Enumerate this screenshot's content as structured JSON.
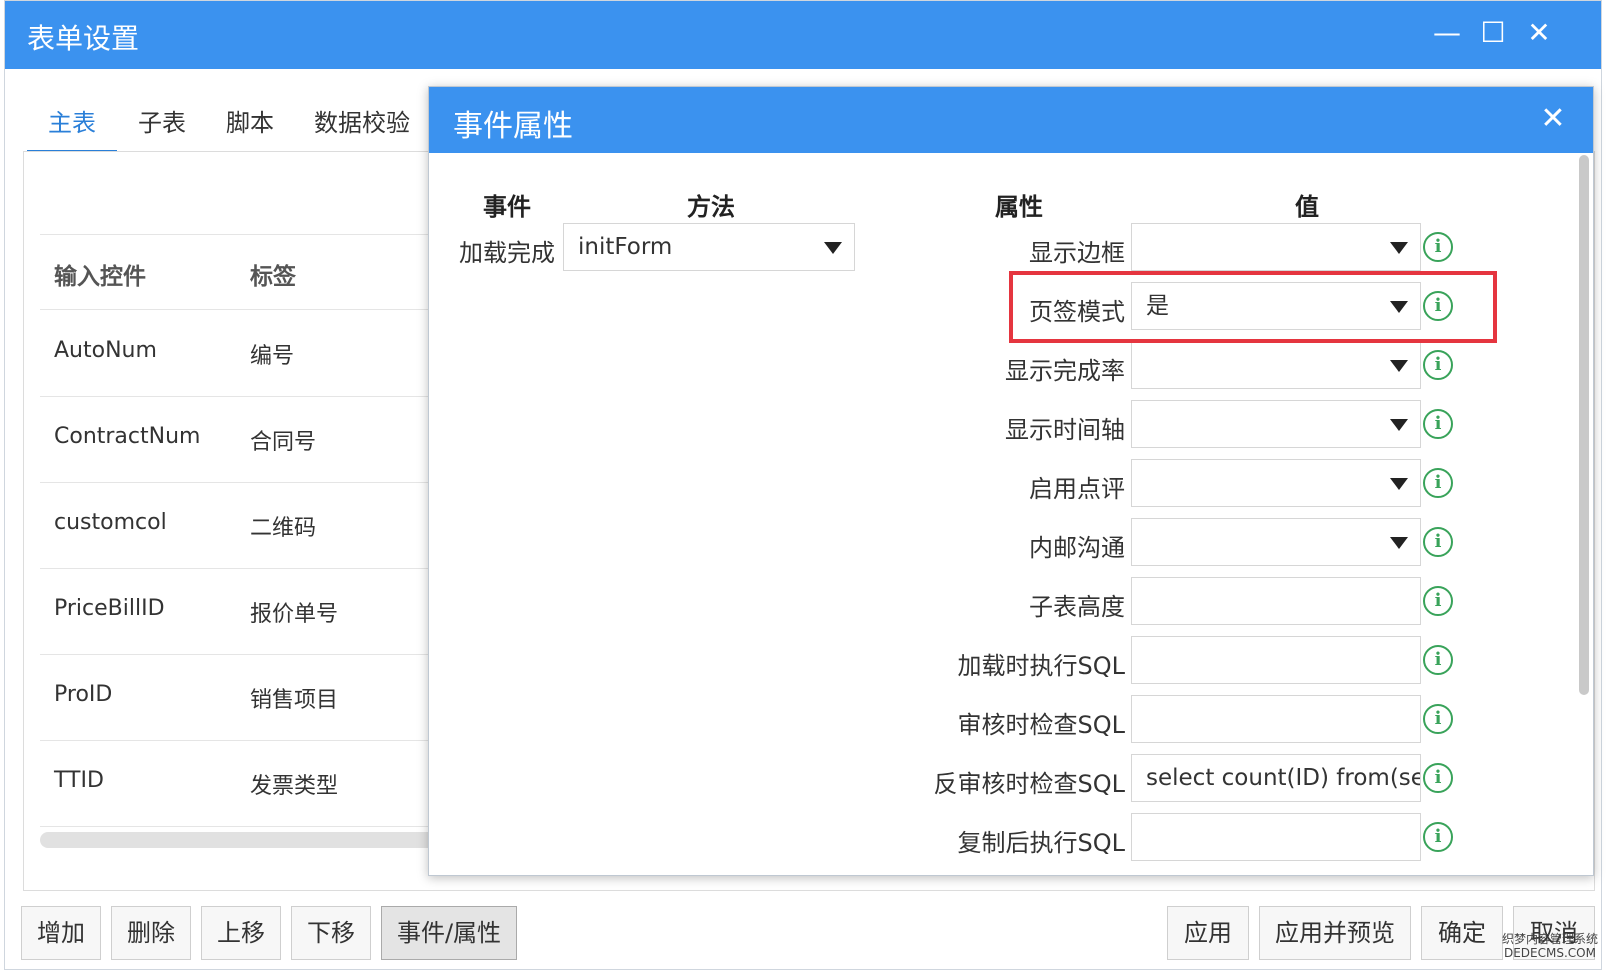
{
  "window": {
    "title": "表单设置"
  },
  "tabs": [
    "主表",
    "子表",
    "脚本",
    "数据校验"
  ],
  "grid": {
    "headers": {
      "control": "输入控件",
      "label": "标签"
    },
    "rows": [
      {
        "control": "AutoNum",
        "label": "编号"
      },
      {
        "control": "ContractNum",
        "label": "合同号"
      },
      {
        "control": "customcol",
        "label": "二维码"
      },
      {
        "control": "PriceBillID",
        "label": "报价单号"
      },
      {
        "control": "ProID",
        "label": "销售项目"
      },
      {
        "control": "TTID",
        "label": "发票类型"
      }
    ]
  },
  "bottom_buttons_left": [
    "增加",
    "删除",
    "上移",
    "下移",
    "事件/属性"
  ],
  "bottom_buttons_right": [
    "应用",
    "应用并预览",
    "确定",
    "取消"
  ],
  "dialog": {
    "title": "事件属性",
    "event_header": "事件",
    "method_header": "方法",
    "property_header": "属性",
    "value_header": "值",
    "event_label": "加载完成",
    "event_method": "initForm",
    "properties": [
      {
        "name": "显示边框",
        "value": "",
        "dropdown": true
      },
      {
        "name": "页签模式",
        "value": "是",
        "dropdown": true
      },
      {
        "name": "显示完成率",
        "value": "",
        "dropdown": true
      },
      {
        "name": "显示时间轴",
        "value": "",
        "dropdown": true
      },
      {
        "name": "启用点评",
        "value": "",
        "dropdown": true
      },
      {
        "name": "内邮沟通",
        "value": "",
        "dropdown": true
      },
      {
        "name": "子表高度",
        "value": "",
        "dropdown": false
      },
      {
        "name": "加载时执行SQL",
        "value": "",
        "dropdown": false
      },
      {
        "name": "审核时检查SQL",
        "value": "",
        "dropdown": false
      },
      {
        "name": "反审核时检查SQL",
        "value": "select count(ID) from(selec",
        "dropdown": false
      },
      {
        "name": "复制后执行SQL",
        "value": "",
        "dropdown": false
      }
    ],
    "info_glyph": "i",
    "close_glyph": "✕"
  },
  "window_controls": {
    "minimize": "—",
    "maximize": "☐",
    "close": "✕"
  },
  "watermark": {
    "line1": "织梦内容管理系统",
    "line2": "DEDECMS.COM"
  },
  "colors": {
    "titlebar": "#3b92ef",
    "active_tab": "#2a7fd8",
    "highlight_box": "#e5353f",
    "info_icon": "#39a35a"
  }
}
